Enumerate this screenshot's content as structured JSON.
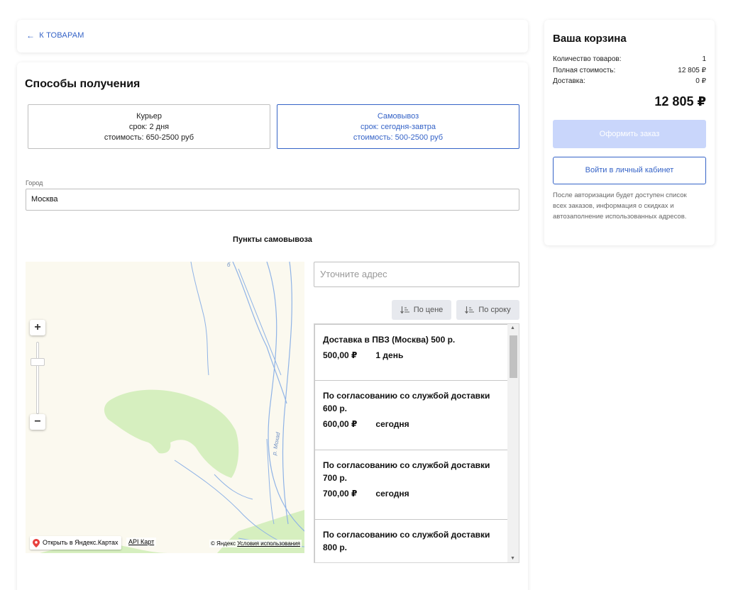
{
  "back": {
    "arrow": "←",
    "label": "К ТОВАРАМ"
  },
  "delivery": {
    "title": "Способы получения",
    "methods": [
      {
        "name": "Курьер",
        "term": "срок: 2 дня",
        "cost": "стоимость: 650-2500 руб"
      },
      {
        "name": "Самовывоз",
        "term": "срок: сегодня-завтра",
        "cost": "стоимость: 500-2500 руб"
      }
    ],
    "selected_method": "Самовывоз",
    "city_label": "Город",
    "city_value": "Москва",
    "points_title": "Пункты самовывоза"
  },
  "map": {
    "zoom_in": "+",
    "zoom_out": "−",
    "open_link": "Открыть в Яндекс.Картах",
    "api_link": "API Карт",
    "copyright": "© Яндекс",
    "terms_link": "Условия использования",
    "river_label_1": "р. Мохаd",
    "river_label_2": "б"
  },
  "address": {
    "placeholder": "Уточните адрес"
  },
  "sort": {
    "by_price": "По цене",
    "by_term": "По сроку"
  },
  "points": [
    {
      "title": "Доставка в ПВЗ (Москва) 500 р.",
      "price": "500,00 ₽",
      "term": "1 день"
    },
    {
      "title": "По согласованию со службой доставки 600 р.",
      "price": "600,00 ₽",
      "term": "сегодня"
    },
    {
      "title": "По согласованию со службой доставки 700 р.",
      "price": "700,00 ₽",
      "term": "сегодня"
    },
    {
      "title": "По согласованию со службой доставки 800 р.",
      "price": "",
      "term": ""
    }
  ],
  "cart": {
    "title": "Ваша корзина",
    "rows": [
      {
        "label": "Количество товаров:",
        "value": "1"
      },
      {
        "label": "Полная стоимость:",
        "value": "12 805 ₽"
      },
      {
        "label": "Доставка:",
        "value": "0 ₽"
      }
    ],
    "total": "12 805 ₽",
    "order_button": "Оформить заказ",
    "login_button": "Войти в личный кабинет",
    "note": "После авторизации будет доступен список всех заказов, информация о скидках и автозаполнение использованных адресов."
  },
  "colors": {
    "accent": "#3563c7",
    "disabled_button": "#c9d6fb",
    "map_green": "#d6efbf",
    "map_water": "#8fb3e6"
  }
}
